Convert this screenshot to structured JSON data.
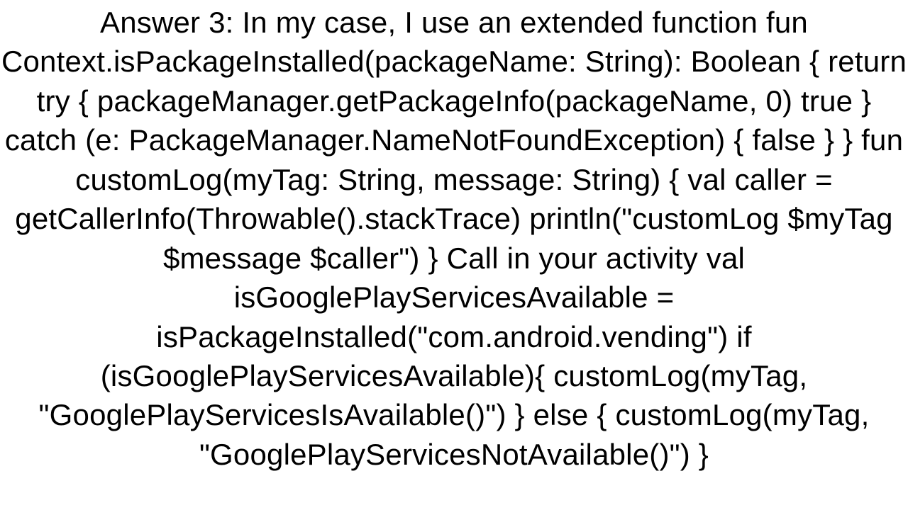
{
  "body": {
    "text": "Answer 3: In my case, I use an extended function fun Context.isPackageInstalled(packageName: String): Boolean {     return try {         packageManager.getPackageInfo(packageName, 0)         true     } catch (e: PackageManager.NameNotFoundException) {         false     } } fun customLog(myTag: String, message: String) {     val caller = getCallerInfo(Throwable().stackTrace)     println(\"customLog $myTag $message $caller\") }  Call in your activity val isGooglePlayServicesAvailable = isPackageInstalled(\"com.android.vending\") if (isGooglePlayServicesAvailable){     customLog(myTag, \"GooglePlayServicesIsAvailable()\") }         else {     customLog(myTag, \"GooglePlayServicesNotAvailable()\") }"
  }
}
